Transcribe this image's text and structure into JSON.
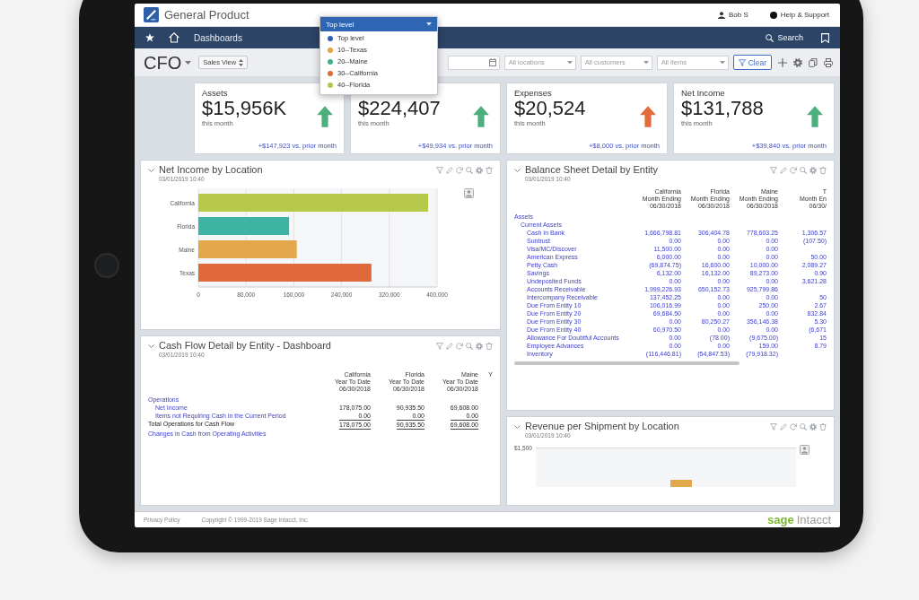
{
  "header": {
    "product_name": "General Product",
    "user": "Bob S",
    "help": "Help & Support"
  },
  "entity_dropdown": {
    "value": "Top level",
    "options": [
      {
        "label": "Top level",
        "color": "#2f5fb3"
      },
      {
        "label": "10--Texas",
        "color": "#e3a43e"
      },
      {
        "label": "20--Maine",
        "color": "#45ad8c"
      },
      {
        "label": "30--California",
        "color": "#e06a34"
      },
      {
        "label": "40--Florida",
        "color": "#b4c64a"
      }
    ]
  },
  "nav": {
    "item": "Dashboards",
    "search": "Search"
  },
  "toolbar": {
    "title": "CFO",
    "view_button": "Sales View",
    "filters": [
      {
        "placeholder": "All locations"
      },
      {
        "placeholder": "All customers"
      },
      {
        "placeholder": "All items"
      }
    ],
    "clear_button": "Clear"
  },
  "kpis": [
    {
      "title": "Assets",
      "value": "$15,956K",
      "period": "this month",
      "change": "+$147,923 vs. prior month",
      "color": "#4caf7d"
    },
    {
      "value": "$224,407",
      "period": "this month",
      "change": "+$49,934 vs. prior month",
      "color": "#4caf7d"
    },
    {
      "title": "Expenses",
      "value": "$20,524",
      "period": "this month",
      "change": "+$8,000 vs. prior month",
      "color": "#e36b3b"
    },
    {
      "title": "Net Income",
      "value": "$131,788",
      "period": "this month",
      "change": "+$39,840 vs. prior month",
      "color": "#4caf7d"
    }
  ],
  "net_income_by_location": {
    "title": "Net Income by Location",
    "timestamp": "03/01/2019 10:40",
    "chart_data": {
      "type": "bar",
      "orientation": "horizontal",
      "categories": [
        "California",
        "Florida",
        "Maine",
        "Texas"
      ],
      "values": [
        385000,
        152000,
        165000,
        290000
      ],
      "colors": [
        "#b6c94b",
        "#3db3a3",
        "#e3a84c",
        "#e0693a"
      ],
      "xlim": [
        0,
        400000
      ],
      "xticks": [
        0,
        {
          "value": 80000,
          "label": "80,000"
        },
        {
          "value": 160000,
          "label": "160,000"
        },
        {
          "value": 240000,
          "label": "240,000"
        },
        {
          "value": 320000,
          "label": "320,000"
        },
        {
          "value": 400000,
          "label": "400,000"
        }
      ],
      "grid": true
    }
  },
  "cash_flow": {
    "title": "Cash Flow Detail by Entity - Dashboard",
    "timestamp": "03/01/2019 10:40",
    "columns": [
      {
        "lines": [
          "California",
          "Year To Date",
          "06/30/2018"
        ]
      },
      {
        "lines": [
          "Florida",
          "Year To Date",
          "06/30/2018"
        ]
      },
      {
        "lines": [
          "Maine",
          "Year To Date",
          "06/30/2018"
        ]
      },
      {
        "lines": [
          "Y"
        ]
      }
    ],
    "rows": [
      {
        "label": "Operations",
        "kind": "link",
        "children": [
          {
            "label": "Net Income",
            "kind": "link",
            "values": [
              "178,075.00",
              "90,935.50",
              "69,608.00"
            ]
          },
          {
            "label": "Items not Requiring Cash in the Current Period",
            "kind": "link",
            "values": [
              "0.00",
              "0.00",
              "0.00"
            ]
          }
        ]
      },
      {
        "label": "Total Operations for Cash Flow",
        "kind": "total",
        "values": [
          "178,075.00",
          "90,935.50",
          "69,608.00"
        ]
      },
      {
        "label": "Changes in Cash from Operating Activities",
        "kind": "link"
      }
    ]
  },
  "balance_sheet": {
    "title": "Balance Sheet Detail by Entity",
    "timestamp": "03/01/2019 10:40",
    "columns": [
      {
        "lines": [
          "California",
          "Month Ending",
          "06/30/2018"
        ]
      },
      {
        "lines": [
          "Florida",
          "Month Ending",
          "06/30/2018"
        ]
      },
      {
        "lines": [
          "Maine",
          "Month Ending",
          "06/30/2018"
        ]
      },
      {
        "lines": [
          "T",
          "Month En",
          "06/30/"
        ]
      }
    ],
    "rows": [
      {
        "label": "Assets",
        "children": [
          {
            "label": "Current Assets",
            "children": [
              {
                "label": "Cash In Bank",
                "values": [
                  "1,666,798.81",
                  "306,404.78",
                  "778,603.25"
                ],
                "column_4": "1,306.57"
              },
              {
                "label": "Suntrust",
                "values": [
                  "0.00",
                  "0.00",
                  "0.00"
                ],
                "column_4": "(107.50)"
              },
              {
                "label": "Visa/MC/Discover",
                "values": [
                  "11,500.00",
                  "0.00",
                  "0.00"
                ]
              },
              {
                "label": "American Express",
                "values": [
                  "6,000.00",
                  "0.00",
                  "0.00"
                ],
                "column_4": "50.00"
              },
              {
                "label": "Petty Cash",
                "values": [
                  "(69,874.75)",
                  "16,600.00",
                  "10,000.00"
                ],
                "column_4": "2,089.27"
              },
              {
                "label": "Savings",
                "values": [
                  "6,132.00",
                  "16,132.00",
                  "89,273.00"
                ],
                "column_4": "0.90"
              },
              {
                "label": "Undeposited Funds",
                "values": [
                  "0.00",
                  "0.00",
                  "0.00"
                ],
                "column_4": "3,621.28"
              },
              {
                "label": "Accounts Receivable",
                "values": [
                  "1,999,226.93",
                  "650,152.73",
                  "925,799.86"
                ]
              },
              {
                "label": "Intercompany Receivable",
                "values": [
                  "137,452.25",
                  "0.00",
                  "0.00"
                ],
                "column_4": "50"
              },
              {
                "label": "Due From Entity 10",
                "values": [
                  "106,016.99",
                  "0.00",
                  "250.00"
                ],
                "column_4": "2.67"
              },
              {
                "label": "Due From Entity 20",
                "values": [
                  "69,684.50",
                  "0.00",
                  "0.00"
                ],
                "column_4": "832.84"
              },
              {
                "label": "Due From Entity 30",
                "values": [
                  "0.00",
                  "80,250.27",
                  "356,146.38"
                ],
                "column_4": "5.30"
              },
              {
                "label": "Due From Entity 40",
                "values": [
                  "60,970.50",
                  "0.00",
                  "0.00"
                ],
                "column_4": "(6,671"
              },
              {
                "label": "Allowance For Doubtful Accounts",
                "values": [
                  "0.00",
                  "(78.00)",
                  "(9,675.00)"
                ],
                "column_4": "15"
              },
              {
                "label": "Employee Advances",
                "values": [
                  "0.00",
                  "0.00",
                  "159.00"
                ],
                "column_4": "8.79"
              },
              {
                "label": "Inventory",
                "values": [
                  "(116,446.81)",
                  "(54,847.53)",
                  "(79,918.32)"
                ]
              }
            ]
          }
        ]
      }
    ]
  },
  "revenue_per_shipment": {
    "title": "Revenue per Shipment by Location",
    "timestamp": "03/01/2019 10:40",
    "y_tick": "$1,500"
  },
  "footer": {
    "privacy_link": "Privacy Policy",
    "copyright": "Copyright © 1999-2019 Sage Intacct, Inc.",
    "logo": {
      "brand": "sage",
      "product": "Intacct"
    }
  }
}
